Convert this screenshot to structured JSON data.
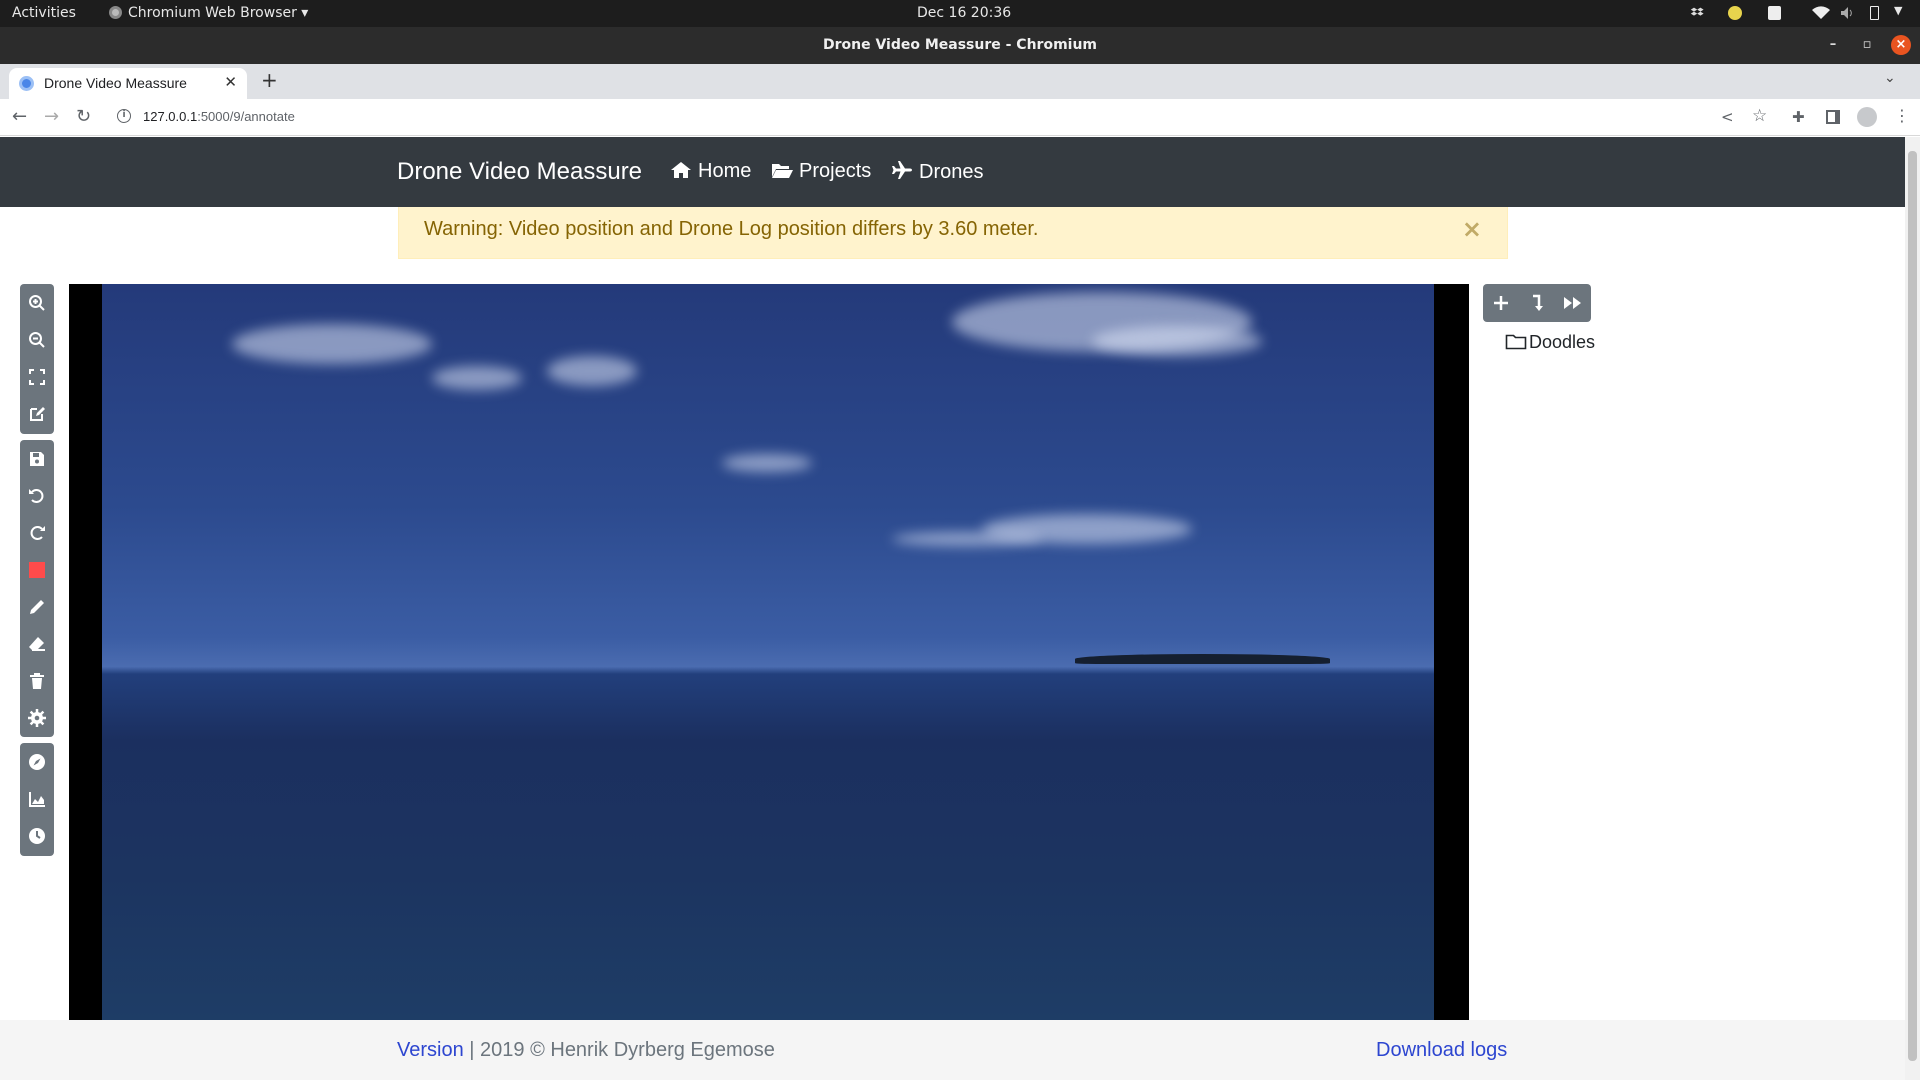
{
  "os_bar": {
    "activities": "Activities",
    "app_menu": "Chromium Web Browser",
    "clock": "Dec 16  20:36"
  },
  "window": {
    "title": "Drone Video Meassure - Chromium"
  },
  "tabs": [
    {
      "label": "Drone Video Meassure"
    }
  ],
  "address_bar": {
    "host": "127.0.0.1",
    "path": ":5000/9/annotate"
  },
  "navbar": {
    "brand": "Drone Video Meassure",
    "links": [
      {
        "label": "Home",
        "icon": "home-icon"
      },
      {
        "label": "Projects",
        "icon": "folder-open-icon"
      },
      {
        "label": "Drones",
        "icon": "plane-icon"
      }
    ]
  },
  "alert": {
    "text": "Warning: Video position and Drone Log position differs by 3.60 meter.",
    "close": "×"
  },
  "left_toolbar": {
    "groups": [
      [
        "zoom-in-icon",
        "zoom-out-icon",
        "fullscreen-icon",
        "edit-icon"
      ],
      [
        "save-icon",
        "undo-icon",
        "redo-icon",
        "color-swatch-icon",
        "pencil-icon",
        "eraser-icon",
        "trash-icon",
        "settings-icon"
      ],
      [
        "compass-icon",
        "chart-icon",
        "clock-icon"
      ]
    ],
    "color_swatch": "#ff4b4b"
  },
  "right_toolbar": {
    "buttons": [
      "plus-icon",
      "step-down-icon",
      "fast-forward-icon"
    ]
  },
  "tree": {
    "items": [
      {
        "label": "Doodles",
        "icon": "folder-icon"
      }
    ]
  },
  "footer": {
    "version_link": "Version",
    "copyright": " | 2019 © Henrik Dyrberg Egemose",
    "download_logs": "Download logs"
  }
}
